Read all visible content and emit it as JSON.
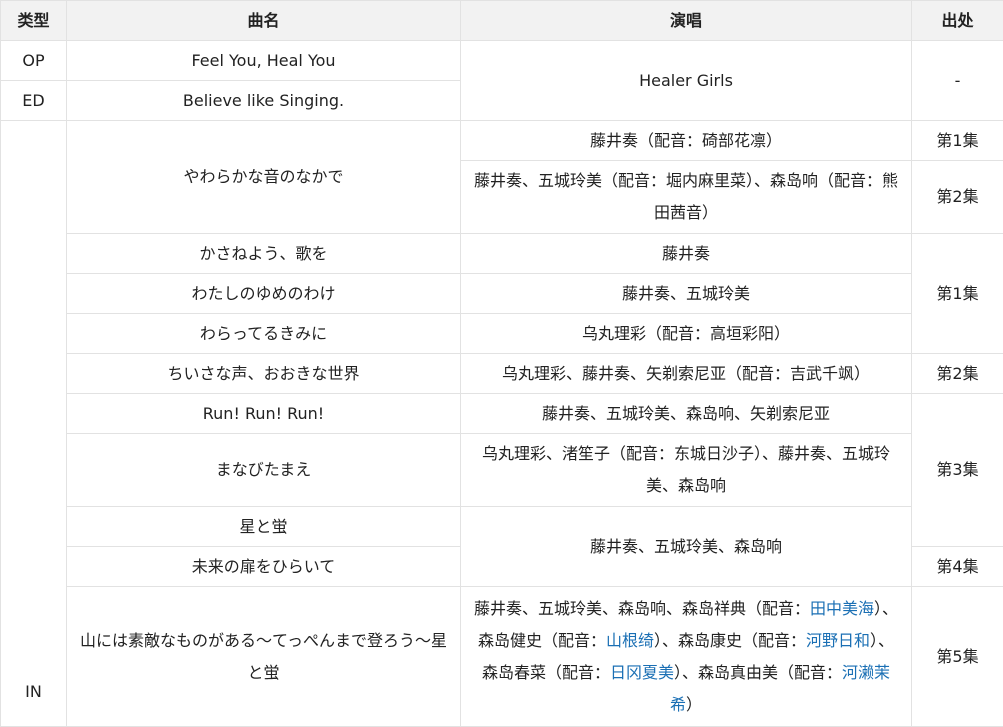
{
  "headers": {
    "type": "类型",
    "song": "曲名",
    "singer": "演唱",
    "source": "出处"
  },
  "rows": {
    "op": {
      "type": "OP",
      "song": "Feel You, Heal You"
    },
    "ed": {
      "type": "ED",
      "song": "Believe like Singing."
    },
    "op_ed_singer": "Healer Girls",
    "op_ed_source": "-",
    "in_type": "IN",
    "r1": {
      "song": "やわらかな音のなかで",
      "singer_a": "藤井奏（配音：碕部花凛）",
      "source_a": "第1集",
      "singer_b": "藤井奏、五城玲美（配音：堀内麻里菜）、森岛响（配音：熊田茜音）",
      "source_b": "第2集"
    },
    "r2": {
      "song": "かさねよう、歌を",
      "singer": "藤井奏"
    },
    "r3": {
      "song": "わたしのゆめのわけ",
      "singer": "藤井奏、五城玲美"
    },
    "r4": {
      "song": "わらってるきみに",
      "singer": "乌丸理彩（配音：高垣彩阳）"
    },
    "r234_source": "第1集",
    "r5": {
      "song": "ちいさな声、おおきな世界",
      "singer": "乌丸理彩、藤井奏、矢剃索尼亚（配音：吉武千飒）",
      "source": "第2集"
    },
    "r6": {
      "song": "Run! Run! Run!",
      "singer": "藤井奏、五城玲美、森岛响、矢剃索尼亚"
    },
    "r7": {
      "song": "まなびたまえ",
      "singer": "乌丸理彩、渚笙子（配音：东城日沙子）、藤井奏、五城玲美、森岛响"
    },
    "r8": {
      "song": "星と蛍"
    },
    "r678_source": "第3集",
    "r9": {
      "song": "未来の扉をひらいて",
      "source": "第4集"
    },
    "r89_singer": "藤井奏、五城玲美、森岛响",
    "r10": {
      "song": "山には素敵なものがある～てっぺんまで登ろう～星と蛍",
      "source": "第5集",
      "t1": "藤井奏、五城玲美、森岛响、森岛祥典（配音：",
      "l1": "田中美海",
      "t2": "）、森岛健史（配音：",
      "l2": "山根绮",
      "t3": "）、森岛康史（配音：",
      "l3": "河野日和",
      "t4": "）、森岛春菜（配音：",
      "l4": "日冈夏美",
      "t5": "）、森岛真由美（配音：",
      "l5": "河濑茉希",
      "t6": "）"
    }
  }
}
